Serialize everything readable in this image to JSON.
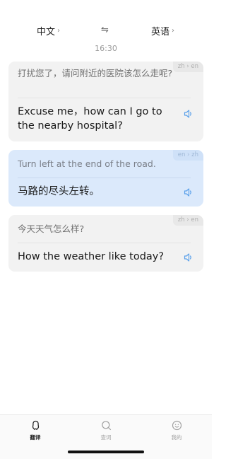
{
  "header": {
    "source_lang": "中文",
    "target_lang": "英语",
    "chevron": "›",
    "swap_icon": "⇋"
  },
  "timestamp": "16:30",
  "conversations": [
    {
      "pair": "zh › en",
      "source": "打扰您了，请问附近的医院该怎么走呢?",
      "target": "Excuse me，how can I go to the nearby hospital?",
      "active": false
    },
    {
      "pair": "en › zh",
      "source": "Turn left at the end of the road.",
      "target": "马路的尽头左转。",
      "active": true
    },
    {
      "pair": "zh › en",
      "source": "今天天气怎么样?",
      "target": "How the weather like today?",
      "active": false
    }
  ],
  "tabs": [
    {
      "label": "翻译",
      "icon": "translate-icon",
      "active": true
    },
    {
      "label": "查词",
      "icon": "search-icon",
      "active": false
    },
    {
      "label": "我的",
      "icon": "profile-icon",
      "active": false
    }
  ],
  "colors": {
    "accent": "#5aa0ea",
    "active_card": "#dbe9fb",
    "card": "#f2f2f2"
  }
}
